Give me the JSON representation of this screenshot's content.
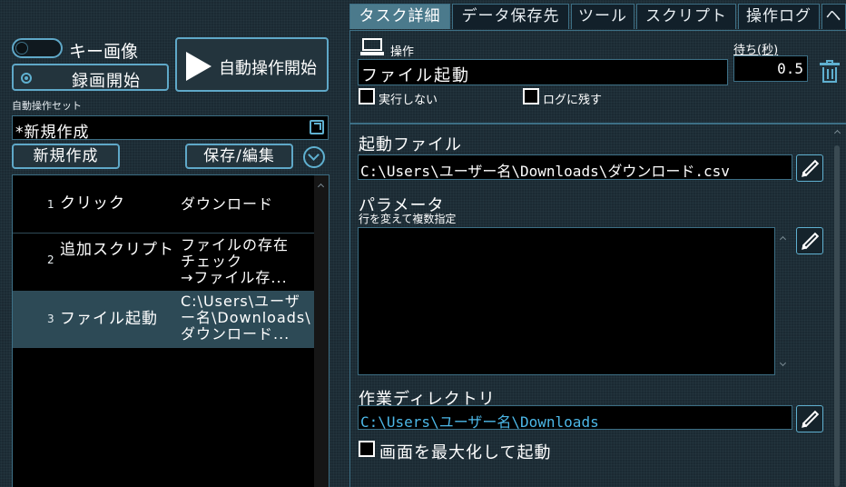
{
  "left": {
    "key_image_label": "キー画像",
    "record_label": "録画開始",
    "auto_start_label": "自動操作開始",
    "set_caption": "自動操作セット",
    "set_name": "*新規作成",
    "new_button": "新規作成",
    "save_button": "保存/編集",
    "tasks": [
      {
        "num": "1",
        "name": "クリック",
        "detail": "ダウンロード"
      },
      {
        "num": "2",
        "name": "追加スクリプト",
        "detail": "ファイルの存在\nチェック\n→ファイル存..."
      },
      {
        "num": "3",
        "name": "ファイル起動",
        "detail": "C:\\Users\\ユーザ\nー名\\Downloads\\\nダウンロード..."
      }
    ]
  },
  "tabs": [
    "タスク詳細",
    "データ保存先",
    "ツール",
    "スクリプト",
    "操作ログ",
    "ヘ"
  ],
  "operation": {
    "label": "操作",
    "value": "ファイル起動",
    "wait_label": "待ち(秒)",
    "wait_value": "0.5",
    "skip_label": "実行しない",
    "log_label": "ログに残す"
  },
  "launch": {
    "file_label": "起動ファイル",
    "file_value": "C:\\Users\\ユーザー名\\Downloads\\ダウンロード.csv",
    "param_label": "パラメータ",
    "param_hint": "行を変えて複数指定",
    "param_value": "",
    "workdir_label": "作業ディレクトリ",
    "workdir_value": "C:\\Users\\ユーザー名\\Downloads",
    "maximize_label": "画面を最大化して起動"
  },
  "colors": {
    "accent": "#5fb0d0",
    "link_text": "#4cb8e8",
    "selected_row": "#2d4a56",
    "active_tab": "#4b7a8c"
  }
}
